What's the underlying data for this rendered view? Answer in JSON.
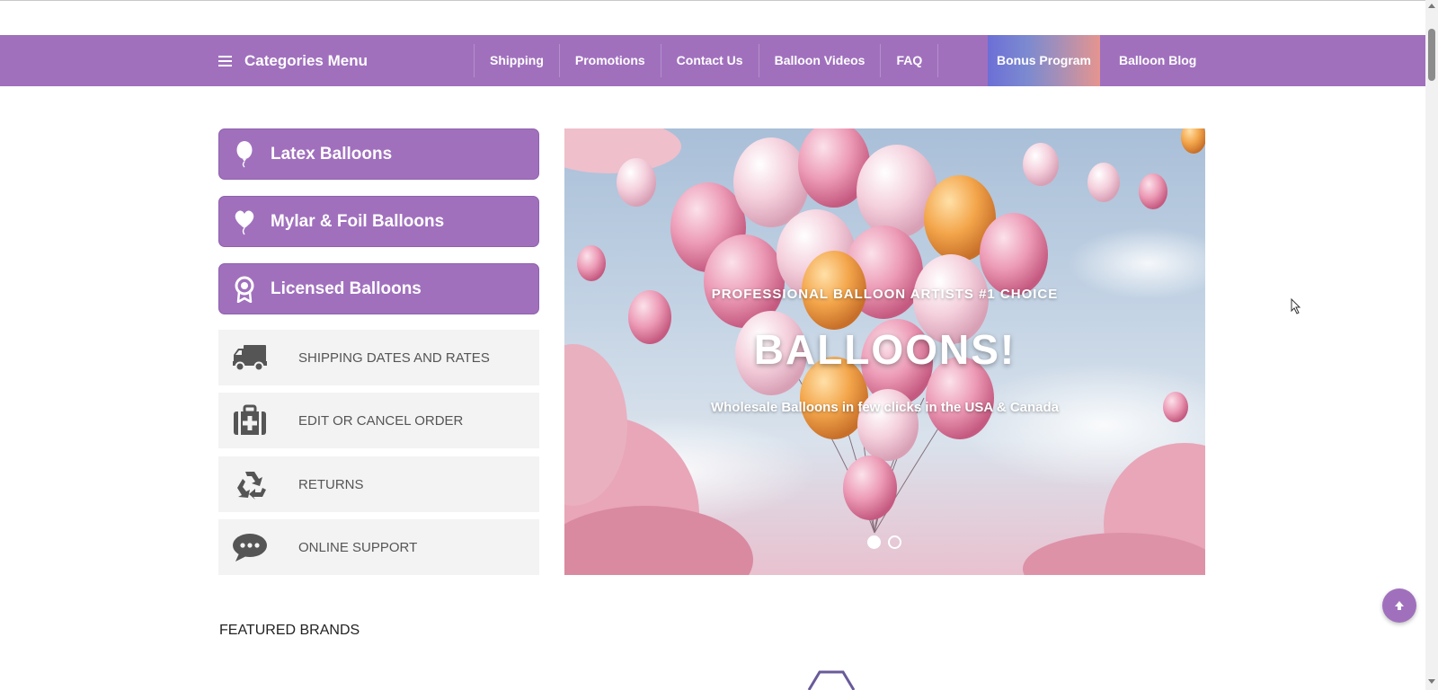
{
  "nav": {
    "categories_label": "Categories Menu",
    "links": [
      "Shipping",
      "Promotions",
      "Contact Us",
      "Balloon Videos",
      "FAQ"
    ],
    "bonus_label": "Bonus Program",
    "blog_label": "Balloon Blog"
  },
  "sidebar": {
    "categories": [
      {
        "label": "Latex Balloons",
        "icon": "balloon-icon"
      },
      {
        "label": "Mylar & Foil Balloons",
        "icon": "heart-balloon-icon"
      },
      {
        "label": "Licensed Balloons",
        "icon": "award-ribbon-icon"
      }
    ],
    "info": [
      {
        "label": "SHIPPING DATES AND RATES",
        "icon": "truck-icon"
      },
      {
        "label": "EDIT OR CANCEL ORDER",
        "icon": "medical-kit-icon"
      },
      {
        "label": "RETURNS",
        "icon": "recycle-icon"
      },
      {
        "label": "ONLINE SUPPORT",
        "icon": "chat-bubble-icon"
      }
    ]
  },
  "hero": {
    "subtitle": "PROFESSIONAL BALLOON ARTISTS #1 CHOICE",
    "title": "BALLOONS!",
    "description": "Wholesale Balloons in few clicks in the USA & Canada",
    "slide_count": 2,
    "active_slide": 1
  },
  "featured": {
    "title": "FEATURED BRANDS"
  },
  "colors": {
    "accent": "#a070bd",
    "info_bg": "#f3f3f3",
    "icon_gray": "#555555"
  }
}
